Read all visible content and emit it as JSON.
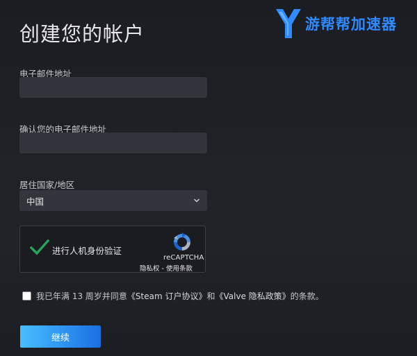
{
  "page": {
    "title": "创建您的帐户"
  },
  "watermark": {
    "text": "游帮帮加速器",
    "color": "#2f8bff"
  },
  "form": {
    "email_label": "电子邮件地址",
    "email_value": "",
    "confirm_email_label": "确认您的电子邮件地址",
    "confirm_email_value": "",
    "country_label": "居住国家/地区",
    "country_value": "中国"
  },
  "captcha": {
    "label": "进行人机身份验证",
    "brand": "reCAPTCHA",
    "privacy_link": "隐私权",
    "separator": " - ",
    "terms_link": "使用条款",
    "check_color": "#26a65b"
  },
  "agreement": {
    "prefix": "我已年满 13 周岁并同意",
    "steam_link": "《Steam 订户协议》",
    "middle": "和",
    "valve_link": "《Valve 隐私政策》",
    "suffix": "的条款。"
  },
  "actions": {
    "continue_label": "继续"
  },
  "colors": {
    "background": "#1f2126",
    "input_bg": "#32353c",
    "button_gradient_start": "#47bfff",
    "button_gradient_end": "#1a6fe3"
  }
}
